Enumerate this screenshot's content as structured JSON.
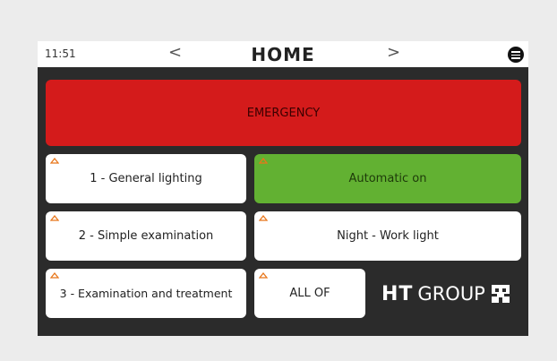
{
  "header": {
    "time": "11:51",
    "title": "HOME",
    "prev_icon": "chevron-left-icon",
    "next_icon": "chevron-right-icon",
    "menu_icon": "menu-icon"
  },
  "buttons": {
    "emergency": "EMERGENCY",
    "general": "1 - General lighting",
    "automatic": "Automatic on",
    "simple": "2 - Simple examination",
    "night": "Night - Work light",
    "exam": "3 - Examination and treatment",
    "alloff": "ALL OF"
  },
  "logo": {
    "ht": "HT",
    "group": "GROUP"
  },
  "colors": {
    "emergency": "#d41b1b",
    "active": "#62b132",
    "indicator": "#e8761a",
    "panel": "#2b2b2b"
  }
}
